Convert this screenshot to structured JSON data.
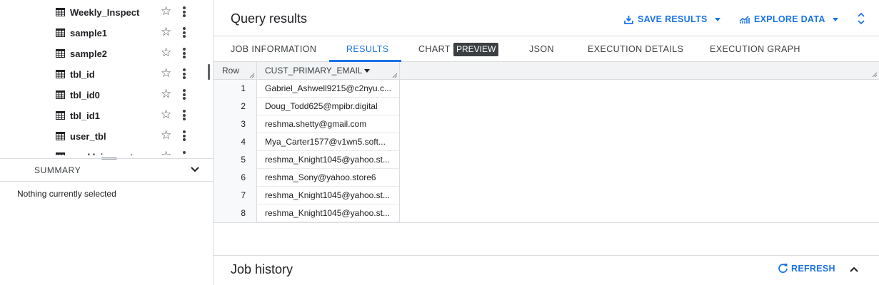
{
  "explorer": {
    "tables": [
      {
        "name": "Weekly_Inspect"
      },
      {
        "name": "sample1"
      },
      {
        "name": "sample2"
      },
      {
        "name": "tbl_id"
      },
      {
        "name": "tbl_id0"
      },
      {
        "name": "tbl_id1"
      },
      {
        "name": "user_tbl"
      },
      {
        "name": "weekl_inspect"
      }
    ]
  },
  "summary": {
    "label": "SUMMARY",
    "empty_text": "Nothing currently selected"
  },
  "query_results": {
    "title": "Query results",
    "save_results_label": "SAVE RESULTS",
    "explore_data_label": "EXPLORE DATA",
    "tabs": [
      {
        "label": "JOB INFORMATION"
      },
      {
        "label": "RESULTS"
      },
      {
        "label": "CHART"
      },
      {
        "label": "JSON"
      },
      {
        "label": "EXECUTION DETAILS"
      },
      {
        "label": "EXECUTION GRAPH"
      }
    ],
    "active_tab": "RESULTS",
    "preview_badge": "PREVIEW",
    "columns": [
      "Row",
      "CUST_PRIMARY_EMAIL"
    ],
    "rows": [
      {
        "row": "1",
        "email": "Gabriel_Ashwell9215@c2nyu.c..."
      },
      {
        "row": "2",
        "email": "Doug_Todd625@mpibr.digital"
      },
      {
        "row": "3",
        "email": "reshma.shetty@gmail.com"
      },
      {
        "row": "4",
        "email": "Mya_Carter1577@v1wn5.soft..."
      },
      {
        "row": "5",
        "email": "reshma_Knight1045@yahoo.st..."
      },
      {
        "row": "6",
        "email": "reshma_Sony@yahoo.store6"
      },
      {
        "row": "7",
        "email": "reshma_Knight1045@yahoo.st..."
      },
      {
        "row": "8",
        "email": "reshma_Knight1045@yahoo.st..."
      }
    ]
  },
  "job_history": {
    "title": "Job history",
    "refresh_label": "REFRESH"
  },
  "colors": {
    "accent": "#1a73e8",
    "text": "#202124",
    "border": "#dadce0",
    "header_bg": "#f1f3f4"
  }
}
